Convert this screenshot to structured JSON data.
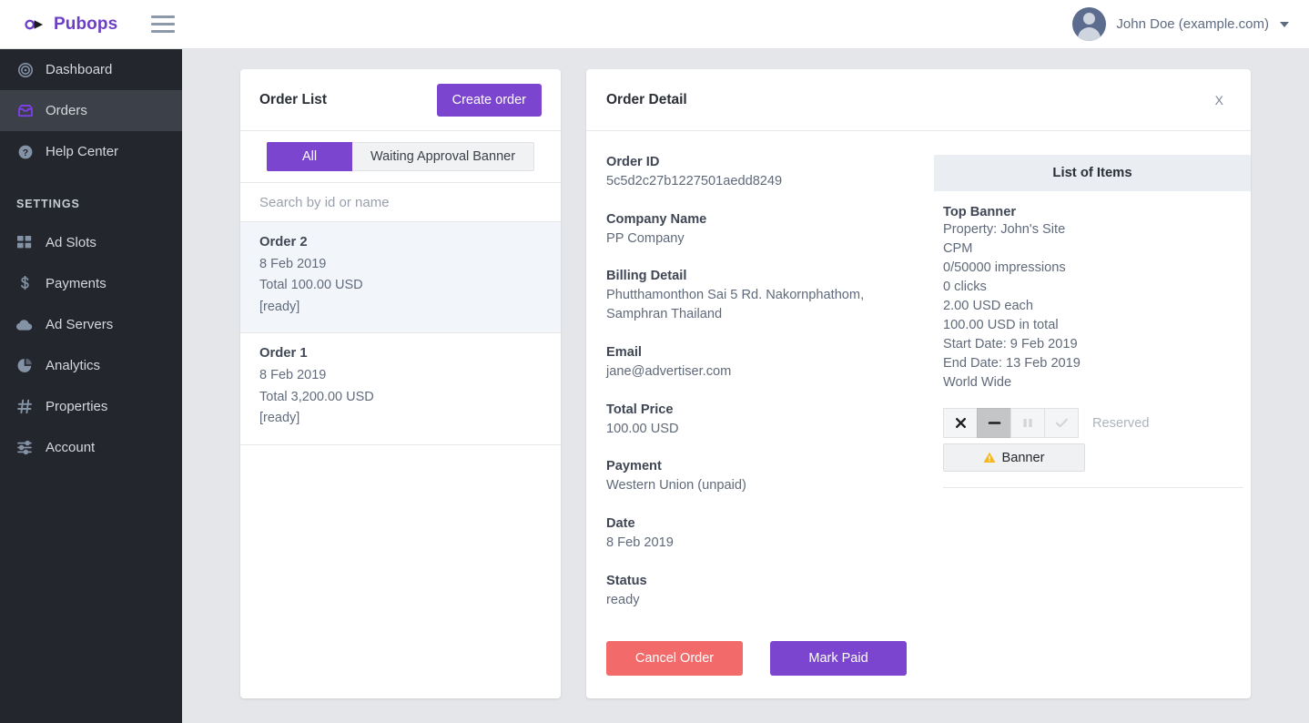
{
  "app": {
    "brand_name": "Pubops",
    "brand_logo_icon": "pubops-knot-logo",
    "hamburger_icon": "hamburger-menu-icon",
    "accent_purple": "#7b45cf",
    "danger_red": "#f26a6a",
    "sidebar_bg": "#24262d",
    "workspace_bg": "#e4e6e9"
  },
  "user": {
    "name": "John Doe (example.com)",
    "avatar_icon": "user-avatar-icon",
    "caret_icon": "chevron-down-icon"
  },
  "sidebar": {
    "items": [
      {
        "label": "Dashboard",
        "icon": "target-icon",
        "active": false
      },
      {
        "label": "Orders",
        "icon": "inbox-icon",
        "active": true
      },
      {
        "label": "Help Center",
        "icon": "question-circle-icon",
        "active": false
      }
    ],
    "settings_heading": "SETTINGS",
    "settings_items": [
      {
        "label": "Ad Slots",
        "icon": "grid-squares-icon"
      },
      {
        "label": "Payments",
        "icon": "dollar-sign-icon"
      },
      {
        "label": "Ad Servers",
        "icon": "cloud-icon"
      },
      {
        "label": "Analytics",
        "icon": "pie-chart-icon"
      },
      {
        "label": "Properties",
        "icon": "hash-icon"
      },
      {
        "label": "Account",
        "icon": "sliders-icon"
      }
    ]
  },
  "order_list": {
    "title": "Order List",
    "create_button": "Create order",
    "tabs": [
      {
        "label": "All",
        "selected": true
      },
      {
        "label": "Waiting Approval Banner",
        "selected": false
      }
    ],
    "search_placeholder": "Search by id or name",
    "search_value": "",
    "orders": [
      {
        "name": "Order 2",
        "date": "8 Feb 2019",
        "total": "Total 100.00 USD",
        "status": "[ready]",
        "selected": true
      },
      {
        "name": "Order 1",
        "date": "8 Feb 2019",
        "total": "Total 3,200.00 USD",
        "status": "[ready]",
        "selected": false
      }
    ]
  },
  "order_detail": {
    "title": "Order Detail",
    "close_label": "X",
    "close_icon": "close-x-icon",
    "fields": [
      {
        "label": "Order ID",
        "value": "5c5d2c27b1227501aedd8249"
      },
      {
        "label": "Company Name",
        "value": "PP Company"
      },
      {
        "label": "Billing Detail",
        "value": "Phutthamonthon Sai 5 Rd. Nakornphathom, Samphran Thailand"
      },
      {
        "label": "Email",
        "value": "jane@advertiser.com"
      },
      {
        "label": "Total Price",
        "value": "100.00 USD"
      },
      {
        "label": "Payment",
        "value": "Western Union (unpaid)"
      },
      {
        "label": "Date",
        "value": "8 Feb 2019"
      },
      {
        "label": "Status",
        "value": "ready"
      }
    ],
    "cancel_button": "Cancel Order",
    "mark_paid_button": "Mark Paid"
  },
  "items_panel": {
    "header": "List of Items",
    "item": {
      "title": "Top Banner",
      "lines": [
        "Property: John's Site",
        "CPM",
        "0/50000 impressions",
        "0 clicks",
        "2.00 USD each",
        "100.00 USD in total",
        "Start Date: 9 Feb 2019",
        "End Date: 13 Feb 2019",
        "World Wide"
      ],
      "state_buttons": [
        {
          "icon": "x-mark-icon",
          "glyph": "✖",
          "state": "normal"
        },
        {
          "icon": "minus-icon",
          "glyph": "—",
          "state": "active"
        },
        {
          "icon": "pause-icon",
          "glyph": "❙❙",
          "state": "disabled"
        },
        {
          "icon": "check-icon",
          "glyph": "✓",
          "state": "disabled"
        }
      ],
      "state_label": "Reserved",
      "creative_button": "Banner",
      "creative_warning_icon": "warning-triangle-icon"
    }
  }
}
